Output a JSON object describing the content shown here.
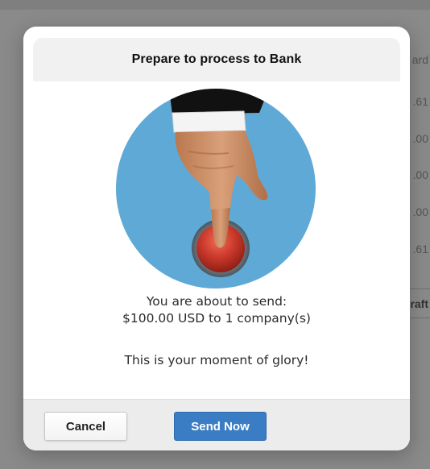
{
  "background": {
    "header_fragment": "ard",
    "values": [
      ".61",
      ".00",
      ".00",
      ".00",
      ".61"
    ],
    "footer_fragment": "raft"
  },
  "modal": {
    "title": "Prepare to process to Bank",
    "illustration_icon": "finger-pressing-red-button-illustration",
    "message_line1": "You are about to send:",
    "message_line2": "$100.00 USD to 1 company(s)",
    "message_line3": "This is your moment of glory!",
    "buttons": {
      "cancel_label": "Cancel",
      "send_label": "Send Now"
    },
    "colors": {
      "primary": "#3b7dc4",
      "illustration_bg": "#5fa9d6",
      "button_red": "#c9372a"
    }
  }
}
